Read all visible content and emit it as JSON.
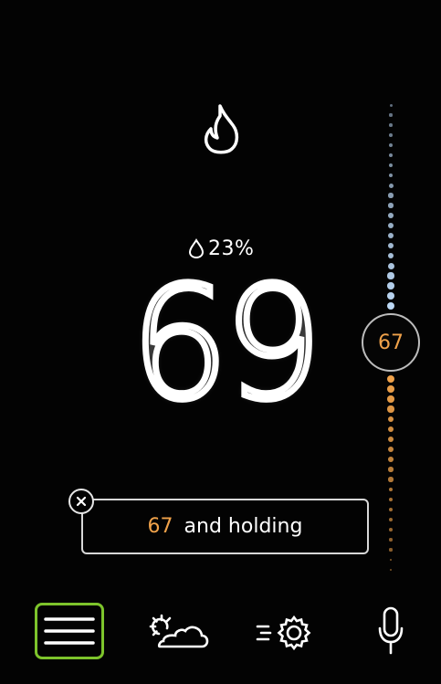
{
  "thermostat": {
    "mode_icon": "flame-icon",
    "humidity": "23%",
    "current_temp": "69",
    "setpoint": "67",
    "hold": {
      "setpoint": "67",
      "label": "and holding"
    }
  },
  "nav": {
    "items": [
      "menu-icon",
      "weather-icon",
      "settings-icon",
      "microphone-icon"
    ]
  },
  "colors": {
    "accent_heat": "#f0a24a",
    "accent_cool": "#bcd8f5",
    "selected_outline": "#7dc42b"
  }
}
